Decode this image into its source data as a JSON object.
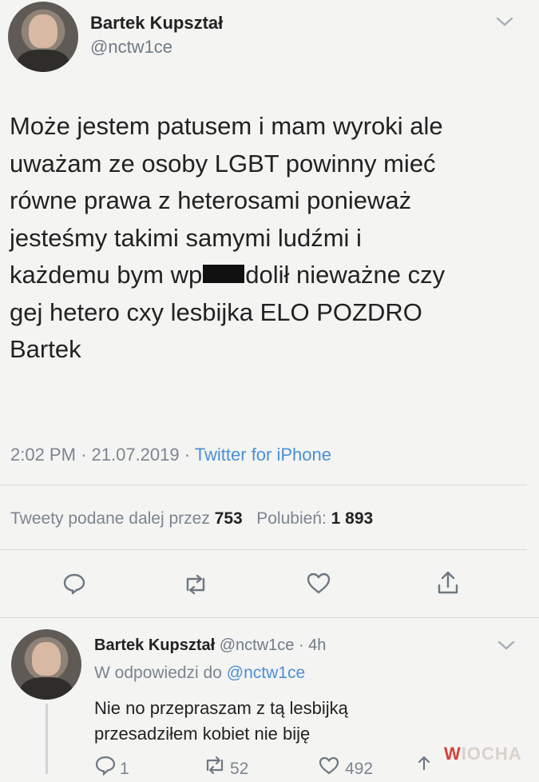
{
  "tweet": {
    "author_name": "Bartek Kupształ",
    "handle": "@nctw1ce",
    "text_before_censor": "Może jestem patusem i mam wyroki ale\nuważam ze osoby LGBT powinny mieć\nrówne prawa z heterosami ponieważ\njesteśmy takimi samymi ludźmi i\nkażdemu bym wp",
    "text_after_censor": "dolił nieważne czy\ngej hetero cxy lesbijka ELO POZDRO\nBartek",
    "time": "2:02 PM",
    "date": "21.07.2019",
    "source": "Twitter for iPhone",
    "retweets_label": "Tweety podane dalej przez",
    "retweets_count": "753",
    "likes_label": "Polubień:",
    "likes_count": "1 893"
  },
  "reply": {
    "author_name": "Bartek Kupształ",
    "handle": "@nctw1ce",
    "time_ago": "4h",
    "replying_to_label": "W odpowiedzi do",
    "replying_to_handle": "@nctw1ce",
    "text": "Nie no przepraszam z tą lesbijką\nprzesadziłem kobiet nie biję",
    "reply_count": "1",
    "retweet_count": "52",
    "like_count": "492"
  },
  "watermark": {
    "brand_letter": "W",
    "brand_rest": "IOCHA"
  },
  "icons": [
    "chevron-down-icon",
    "reply-icon",
    "retweet-icon",
    "like-icon",
    "share-icon"
  ],
  "colors": {
    "link": "#4b8fd8",
    "meta": "#7b858f",
    "text": "#222222",
    "background": "#f4f4f2"
  }
}
